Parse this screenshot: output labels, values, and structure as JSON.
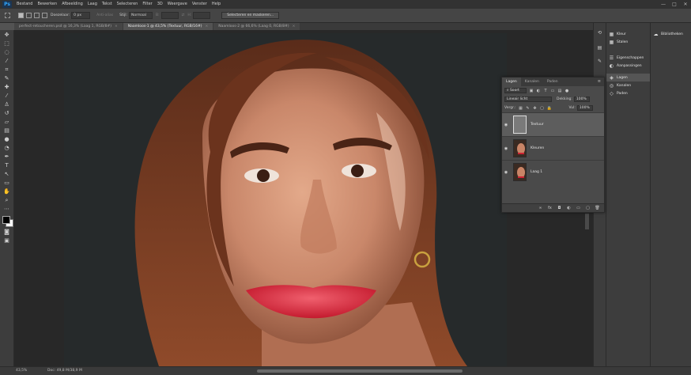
{
  "app": {
    "logo": "Ps"
  },
  "menu": [
    "Bestand",
    "Bewerken",
    "Afbeelding",
    "Laag",
    "Tekst",
    "Selecteren",
    "Filter",
    "3D",
    "Weergave",
    "Venster",
    "Help"
  ],
  "window_controls": [
    "—",
    "□",
    "✕"
  ],
  "options_bar": {
    "doezelaar_label": "Doezelaar:",
    "doezelaar_value": "0 px",
    "anti_alias_label": "Anti-alias",
    "stijl_label": "Stijl:",
    "stijl_value": "Normaal",
    "breedte_label": "B:",
    "hoogte_label": "H:",
    "select_mask_button": "Selecteren en maskeren..."
  },
  "tabs": [
    {
      "label": "perfect-retoucheren.psd @ 16,3% (Laag 1, RGB/8#)",
      "active": false
    },
    {
      "label": "Naamloos-1 @ 43,5% (Textuur, RGB/16#)",
      "active": true
    },
    {
      "label": "Naamloos-2 @ 66,6% (Laag 0, RGB/8#)",
      "active": false
    }
  ],
  "status": {
    "zoom": "43,5%",
    "doc": "Doc: 49,8 M/38,9 M"
  },
  "dock_panels_1": {
    "group1": [
      {
        "icon": "grid-icon",
        "label": "Kleur"
      },
      {
        "icon": "grid-icon",
        "label": "Stalen"
      }
    ],
    "group2": [
      {
        "icon": "sliders-icon",
        "label": "Eigenschappen"
      },
      {
        "icon": "half-circle-icon",
        "label": "Aanpassingen"
      }
    ],
    "group3": [
      {
        "icon": "layers-icon",
        "label": "Lagen"
      },
      {
        "icon": "channels-icon",
        "label": "Kanalen"
      },
      {
        "icon": "paths-icon",
        "label": "Paden"
      }
    ]
  },
  "dock_panels_2": [
    {
      "icon": "library-icon",
      "label": "Bibliotheken"
    }
  ],
  "layers_panel": {
    "tabs": [
      "Lagen",
      "Kanalen",
      "Paden"
    ],
    "menu": "≡",
    "filter_label": "Soort",
    "blend_mode": "Lineair licht",
    "opacity_label": "Dekking:",
    "opacity_value": "100%",
    "lock_label": "Vergr.:",
    "fill_label": "Vul:",
    "fill_value": "100%",
    "layers": [
      {
        "name": "Textuur",
        "type": "gray",
        "selected": true
      },
      {
        "name": "Kleuren",
        "type": "photo",
        "selected": false
      },
      {
        "name": "Laag 1",
        "type": "photo",
        "selected": false
      }
    ],
    "bottom_icons": [
      "∞",
      "fx",
      "◘",
      "◐",
      "▭",
      "▢",
      "🗑"
    ]
  }
}
